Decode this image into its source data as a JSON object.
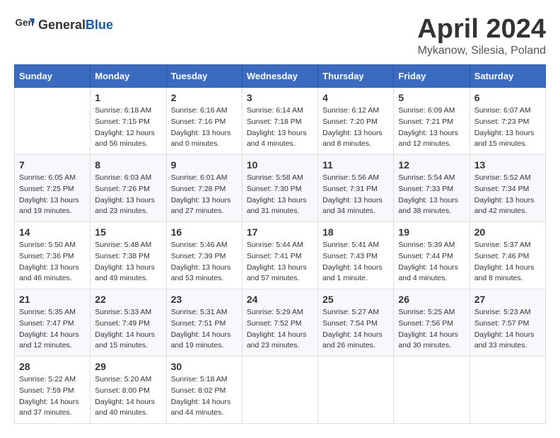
{
  "logo": {
    "text_general": "General",
    "text_blue": "Blue"
  },
  "title": "April 2024",
  "location": "Mykanow, Silesia, Poland",
  "days_of_week": [
    "Sunday",
    "Monday",
    "Tuesday",
    "Wednesday",
    "Thursday",
    "Friday",
    "Saturday"
  ],
  "weeks": [
    [
      {
        "day": "",
        "info": ""
      },
      {
        "day": "1",
        "info": "Sunrise: 6:18 AM\nSunset: 7:15 PM\nDaylight: 12 hours\nand 56 minutes."
      },
      {
        "day": "2",
        "info": "Sunrise: 6:16 AM\nSunset: 7:16 PM\nDaylight: 13 hours\nand 0 minutes."
      },
      {
        "day": "3",
        "info": "Sunrise: 6:14 AM\nSunset: 7:18 PM\nDaylight: 13 hours\nand 4 minutes."
      },
      {
        "day": "4",
        "info": "Sunrise: 6:12 AM\nSunset: 7:20 PM\nDaylight: 13 hours\nand 8 minutes."
      },
      {
        "day": "5",
        "info": "Sunrise: 6:09 AM\nSunset: 7:21 PM\nDaylight: 13 hours\nand 12 minutes."
      },
      {
        "day": "6",
        "info": "Sunrise: 6:07 AM\nSunset: 7:23 PM\nDaylight: 13 hours\nand 15 minutes."
      }
    ],
    [
      {
        "day": "7",
        "info": "Sunrise: 6:05 AM\nSunset: 7:25 PM\nDaylight: 13 hours\nand 19 minutes."
      },
      {
        "day": "8",
        "info": "Sunrise: 6:03 AM\nSunset: 7:26 PM\nDaylight: 13 hours\nand 23 minutes."
      },
      {
        "day": "9",
        "info": "Sunrise: 6:01 AM\nSunset: 7:28 PM\nDaylight: 13 hours\nand 27 minutes."
      },
      {
        "day": "10",
        "info": "Sunrise: 5:58 AM\nSunset: 7:30 PM\nDaylight: 13 hours\nand 31 minutes."
      },
      {
        "day": "11",
        "info": "Sunrise: 5:56 AM\nSunset: 7:31 PM\nDaylight: 13 hours\nand 34 minutes."
      },
      {
        "day": "12",
        "info": "Sunrise: 5:54 AM\nSunset: 7:33 PM\nDaylight: 13 hours\nand 38 minutes."
      },
      {
        "day": "13",
        "info": "Sunrise: 5:52 AM\nSunset: 7:34 PM\nDaylight: 13 hours\nand 42 minutes."
      }
    ],
    [
      {
        "day": "14",
        "info": "Sunrise: 5:50 AM\nSunset: 7:36 PM\nDaylight: 13 hours\nand 46 minutes."
      },
      {
        "day": "15",
        "info": "Sunrise: 5:48 AM\nSunset: 7:38 PM\nDaylight: 13 hours\nand 49 minutes."
      },
      {
        "day": "16",
        "info": "Sunrise: 5:46 AM\nSunset: 7:39 PM\nDaylight: 13 hours\nand 53 minutes."
      },
      {
        "day": "17",
        "info": "Sunrise: 5:44 AM\nSunset: 7:41 PM\nDaylight: 13 hours\nand 57 minutes."
      },
      {
        "day": "18",
        "info": "Sunrise: 5:41 AM\nSunset: 7:43 PM\nDaylight: 14 hours\nand 1 minute."
      },
      {
        "day": "19",
        "info": "Sunrise: 5:39 AM\nSunset: 7:44 PM\nDaylight: 14 hours\nand 4 minutes."
      },
      {
        "day": "20",
        "info": "Sunrise: 5:37 AM\nSunset: 7:46 PM\nDaylight: 14 hours\nand 8 minutes."
      }
    ],
    [
      {
        "day": "21",
        "info": "Sunrise: 5:35 AM\nSunset: 7:47 PM\nDaylight: 14 hours\nand 12 minutes."
      },
      {
        "day": "22",
        "info": "Sunrise: 5:33 AM\nSunset: 7:49 PM\nDaylight: 14 hours\nand 15 minutes."
      },
      {
        "day": "23",
        "info": "Sunrise: 5:31 AM\nSunset: 7:51 PM\nDaylight: 14 hours\nand 19 minutes."
      },
      {
        "day": "24",
        "info": "Sunrise: 5:29 AM\nSunset: 7:52 PM\nDaylight: 14 hours\nand 23 minutes."
      },
      {
        "day": "25",
        "info": "Sunrise: 5:27 AM\nSunset: 7:54 PM\nDaylight: 14 hours\nand 26 minutes."
      },
      {
        "day": "26",
        "info": "Sunrise: 5:25 AM\nSunset: 7:56 PM\nDaylight: 14 hours\nand 30 minutes."
      },
      {
        "day": "27",
        "info": "Sunrise: 5:23 AM\nSunset: 7:57 PM\nDaylight: 14 hours\nand 33 minutes."
      }
    ],
    [
      {
        "day": "28",
        "info": "Sunrise: 5:22 AM\nSunset: 7:59 PM\nDaylight: 14 hours\nand 37 minutes."
      },
      {
        "day": "29",
        "info": "Sunrise: 5:20 AM\nSunset: 8:00 PM\nDaylight: 14 hours\nand 40 minutes."
      },
      {
        "day": "30",
        "info": "Sunrise: 5:18 AM\nSunset: 8:02 PM\nDaylight: 14 hours\nand 44 minutes."
      },
      {
        "day": "",
        "info": ""
      },
      {
        "day": "",
        "info": ""
      },
      {
        "day": "",
        "info": ""
      },
      {
        "day": "",
        "info": ""
      }
    ]
  ]
}
